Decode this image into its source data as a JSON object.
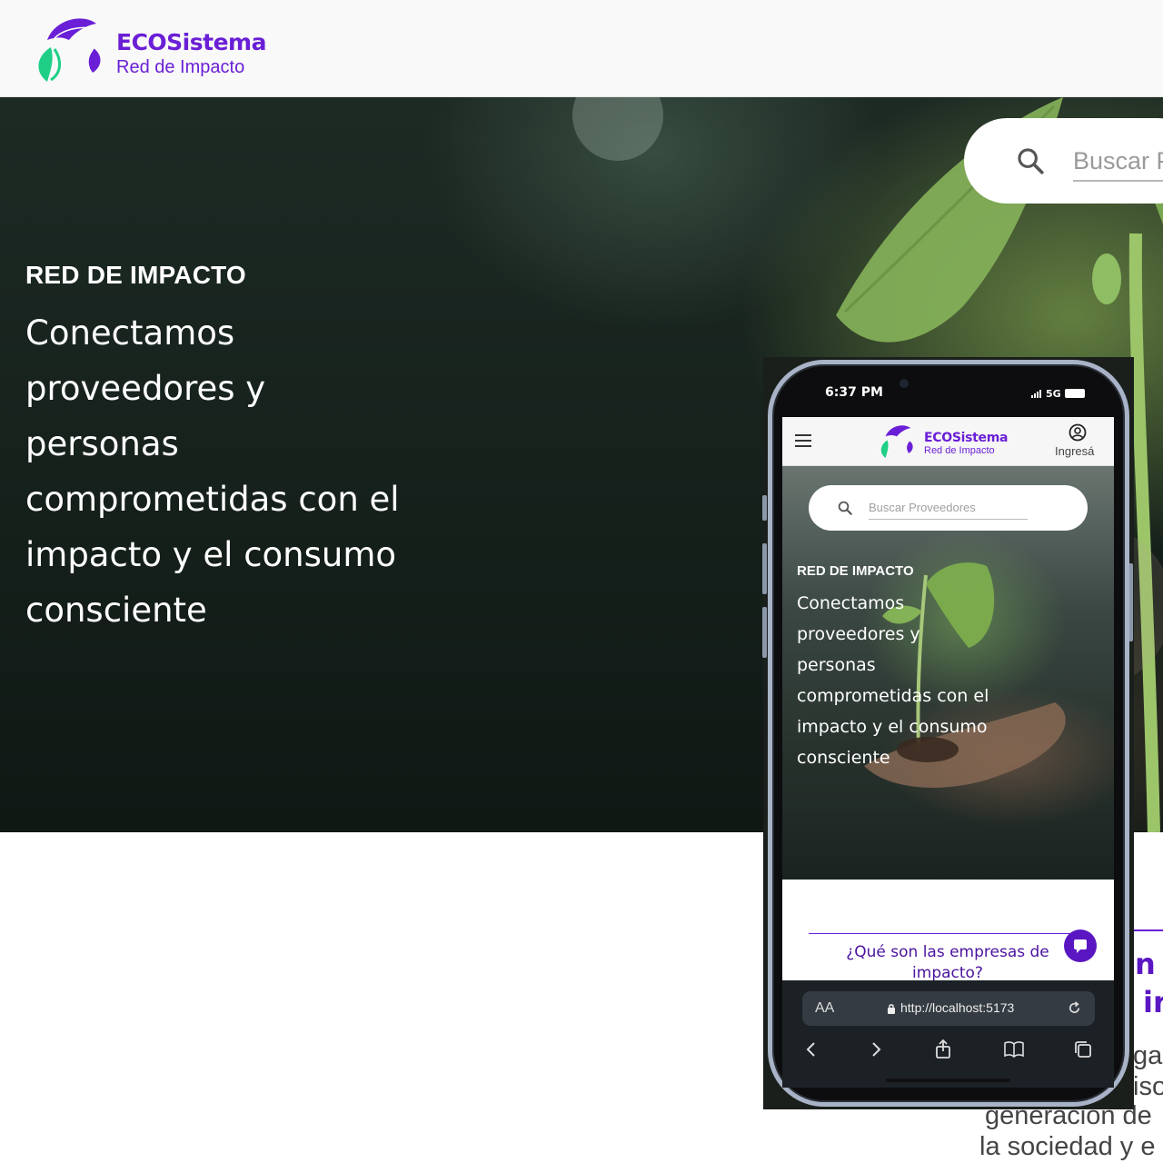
{
  "brand": {
    "title": "ECOSistema",
    "subtitle": "Red de Impacto",
    "colors": {
      "primary": "#6a1fd6",
      "leaf": "#1fcf86"
    }
  },
  "search": {
    "placeholder": "Buscar Proveedores",
    "icon": "search-icon"
  },
  "hero": {
    "kicker": "RED DE IMPACTO",
    "lines": [
      "Conectamos",
      "proveedores y",
      "personas",
      "comprometidas con el",
      "impacto y el consumo",
      "consciente"
    ]
  },
  "desktop_below": {
    "heading_fragments": [
      "n",
      "ir"
    ],
    "paragraph_fragments": [
      "ga",
      "iso",
      "generación de",
      "la sociedad y e"
    ]
  },
  "phone": {
    "status": {
      "time": "6:37 PM",
      "network": "5G"
    },
    "header": {
      "login_label": "Ingresá",
      "menu_icon": "hamburger-icon",
      "user_icon": "user-circle-icon"
    },
    "search_placeholder": "Buscar Proveedores",
    "hero": {
      "kicker": "RED DE IMPACTO",
      "lines": [
        "Conectamos",
        "proveedores y",
        "personas",
        "comprometidas con el",
        "impacto y el consumo",
        "consciente"
      ]
    },
    "section_question": "¿Qué son las empresas de impacto?",
    "browser": {
      "aa_label": "AA",
      "url": "http://localhost:5173"
    }
  }
}
